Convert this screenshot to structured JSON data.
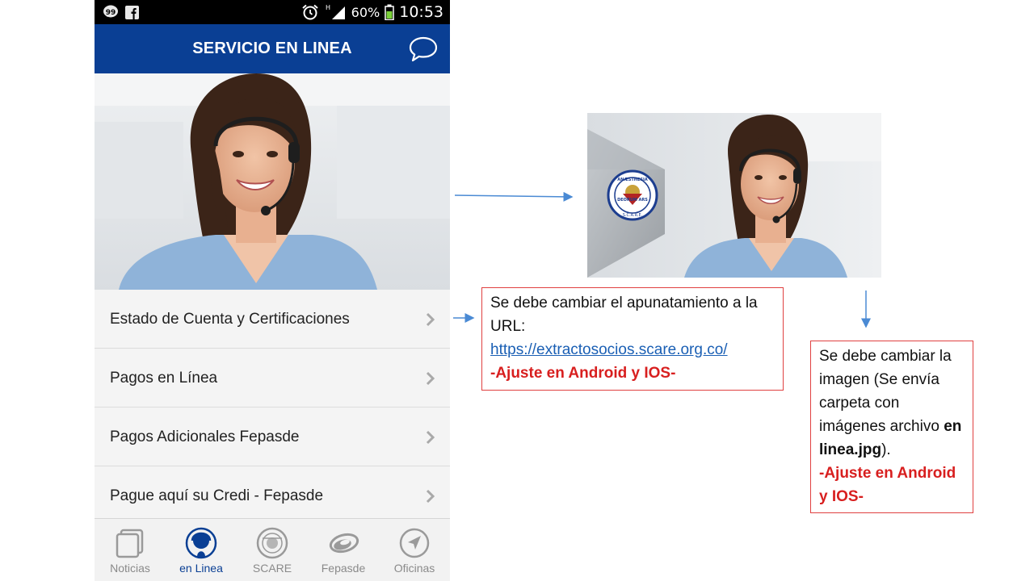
{
  "phone": {
    "status_bar": {
      "battery_percent": "60%",
      "time": "10:53",
      "network_label": "H",
      "icons": [
        "messenger-icon",
        "facebook-icon",
        "alarm-icon",
        "signal-icon",
        "battery-icon"
      ]
    },
    "app_bar": {
      "title": "SERVICIO EN LINEA",
      "action_icon": "chat-bubble-icon"
    },
    "hero_image": "customer-service-agent-with-headset",
    "menu_items": [
      {
        "label": "Estado de Cuenta y Certificaciones"
      },
      {
        "label": "Pagos en Línea"
      },
      {
        "label": "Pagos Adicionales Fepasde"
      },
      {
        "label": "Pague aquí su Credi - Fepasde"
      }
    ],
    "tabs": [
      {
        "label": "Noticias",
        "icon": "news-icon",
        "active": false
      },
      {
        "label": "en Linea",
        "icon": "agent-headset-icon",
        "active": true
      },
      {
        "label": "SCARE",
        "icon": "scare-seal-icon",
        "active": false
      },
      {
        "label": "Fepasde",
        "icon": "fepasde-logo-icon",
        "active": false
      },
      {
        "label": "Oficinas",
        "icon": "location-arrow-icon",
        "active": false
      }
    ]
  },
  "new_image": {
    "description_icon": "scare-seal-with-agent",
    "seal_text_top": "ANÆSTHESIA",
    "seal_text_band": "DEORUM ARS",
    "seal_text_bottom": "S.C.A.R.E."
  },
  "annotations": {
    "note1": {
      "line1": "Se debe cambiar el apunatamiento a la URL:",
      "url": "https://extractosocios.scare.org.co/",
      "platform": "-Ajuste en Android y IOS-"
    },
    "note2": {
      "text_before": "Se debe cambiar la imagen (Se envía carpeta con imágenes archivo ",
      "filename": "en linea.jpg",
      "text_after": ").",
      "platform": "-Ajuste en Android y IOS-"
    }
  },
  "colors": {
    "app_bar": "#0a3f94",
    "annotation_border": "#e04040",
    "annotation_red": "#d81f1f",
    "link": "#1a5fb4",
    "arrow": "#4a8ad4"
  }
}
